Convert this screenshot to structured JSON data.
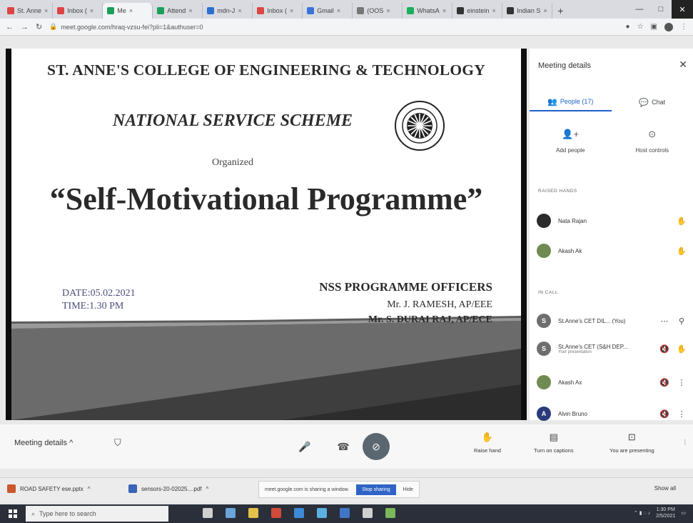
{
  "browser": {
    "tabs": [
      {
        "label": "St. Anne",
        "color": "#d44"
      },
      {
        "label": "Inbox (",
        "color": "#d44"
      },
      {
        "label": "Me",
        "color": "#1a9e5c",
        "active": true
      },
      {
        "label": "Attend",
        "color": "#1a9e5c"
      },
      {
        "label": "mdn-J",
        "color": "#2a6fd1"
      },
      {
        "label": "Inbox (",
        "color": "#d44"
      },
      {
        "label": "Gmail",
        "color": "#3b73d8"
      },
      {
        "label": "(OOS",
        "color": "#777"
      },
      {
        "label": "WhatsA",
        "color": "#1bae5b"
      },
      {
        "label": "einstein",
        "color": "#333"
      },
      {
        "label": "Indian S",
        "color": "#333"
      }
    ],
    "new_tab": "+",
    "url": "meet.google.com/hraq-vzsu-fei?pli=1&authuser=0"
  },
  "slide": {
    "college": "ST. ANNE'S COLLEGE OF ENGINEERING & TECHNOLOGY",
    "scheme": "NATIONAL SERVICE SCHEME",
    "organized": "Organized",
    "title": "“Self-Motivational Programme”",
    "date": "DATE:05.02.2021",
    "time": "TIME:1.30 PM",
    "officers_heading": "NSS PROGRAMME OFFICERS",
    "officer1": "Mr. J. RAMESH, AP/EEE",
    "officer2": "Mr. S. DURAI RAJ, AP/ECE"
  },
  "panel": {
    "title": "Meeting details",
    "tab_people": "People (17)",
    "tab_chat": "Chat",
    "add_people": "Add people",
    "host_controls": "Host controls",
    "raised_hands_heading": "RAISED HANDS",
    "in_call_heading": "IN CALL",
    "raised": [
      {
        "name": "Nata Rajan",
        "color": "#2b2b2b"
      },
      {
        "name": "Akash Ak",
        "color": "#6f8a52"
      }
    ],
    "in_call": [
      {
        "name": "St.Anne's CET DIL... (You)",
        "sub": "",
        "color": "#6e6e6e",
        "initial": "S"
      },
      {
        "name": "St.Anne's CET (S&H DEP...",
        "sub": "Your presentation",
        "color": "#6e6e6e",
        "initial": "S"
      },
      {
        "name": "Akash Ax",
        "sub": "",
        "color": "#6f8a52",
        "initial": ""
      },
      {
        "name": "Alvin Bruno",
        "sub": "",
        "color": "#2b3a7a",
        "initial": "A"
      }
    ]
  },
  "toolbar": {
    "meeting_details": "Meeting details",
    "raise_hand": "Raise hand",
    "captions": "Turn on captions",
    "presenting": "You are presenting"
  },
  "downloads": {
    "file1": "ROAD SAFETY ese.pptx",
    "file2": "sensors-20-02025....pdf",
    "share_text": "meet.google.com is sharing a window.",
    "stop_sharing": "Stop sharing",
    "hide": "Hide",
    "show_all": "Show all"
  },
  "taskbar": {
    "search_placeholder": "Type here to search",
    "time": "1:30 PM",
    "date": "2/5/2021",
    "app_colors": [
      "#cfcfcf",
      "#6aa5d8",
      "#e3c14a",
      "#d04b3b",
      "#3c8ad8",
      "#5bb0e0",
      "#3f76c7",
      "#d0d0d0",
      "#7ab85a"
    ]
  }
}
